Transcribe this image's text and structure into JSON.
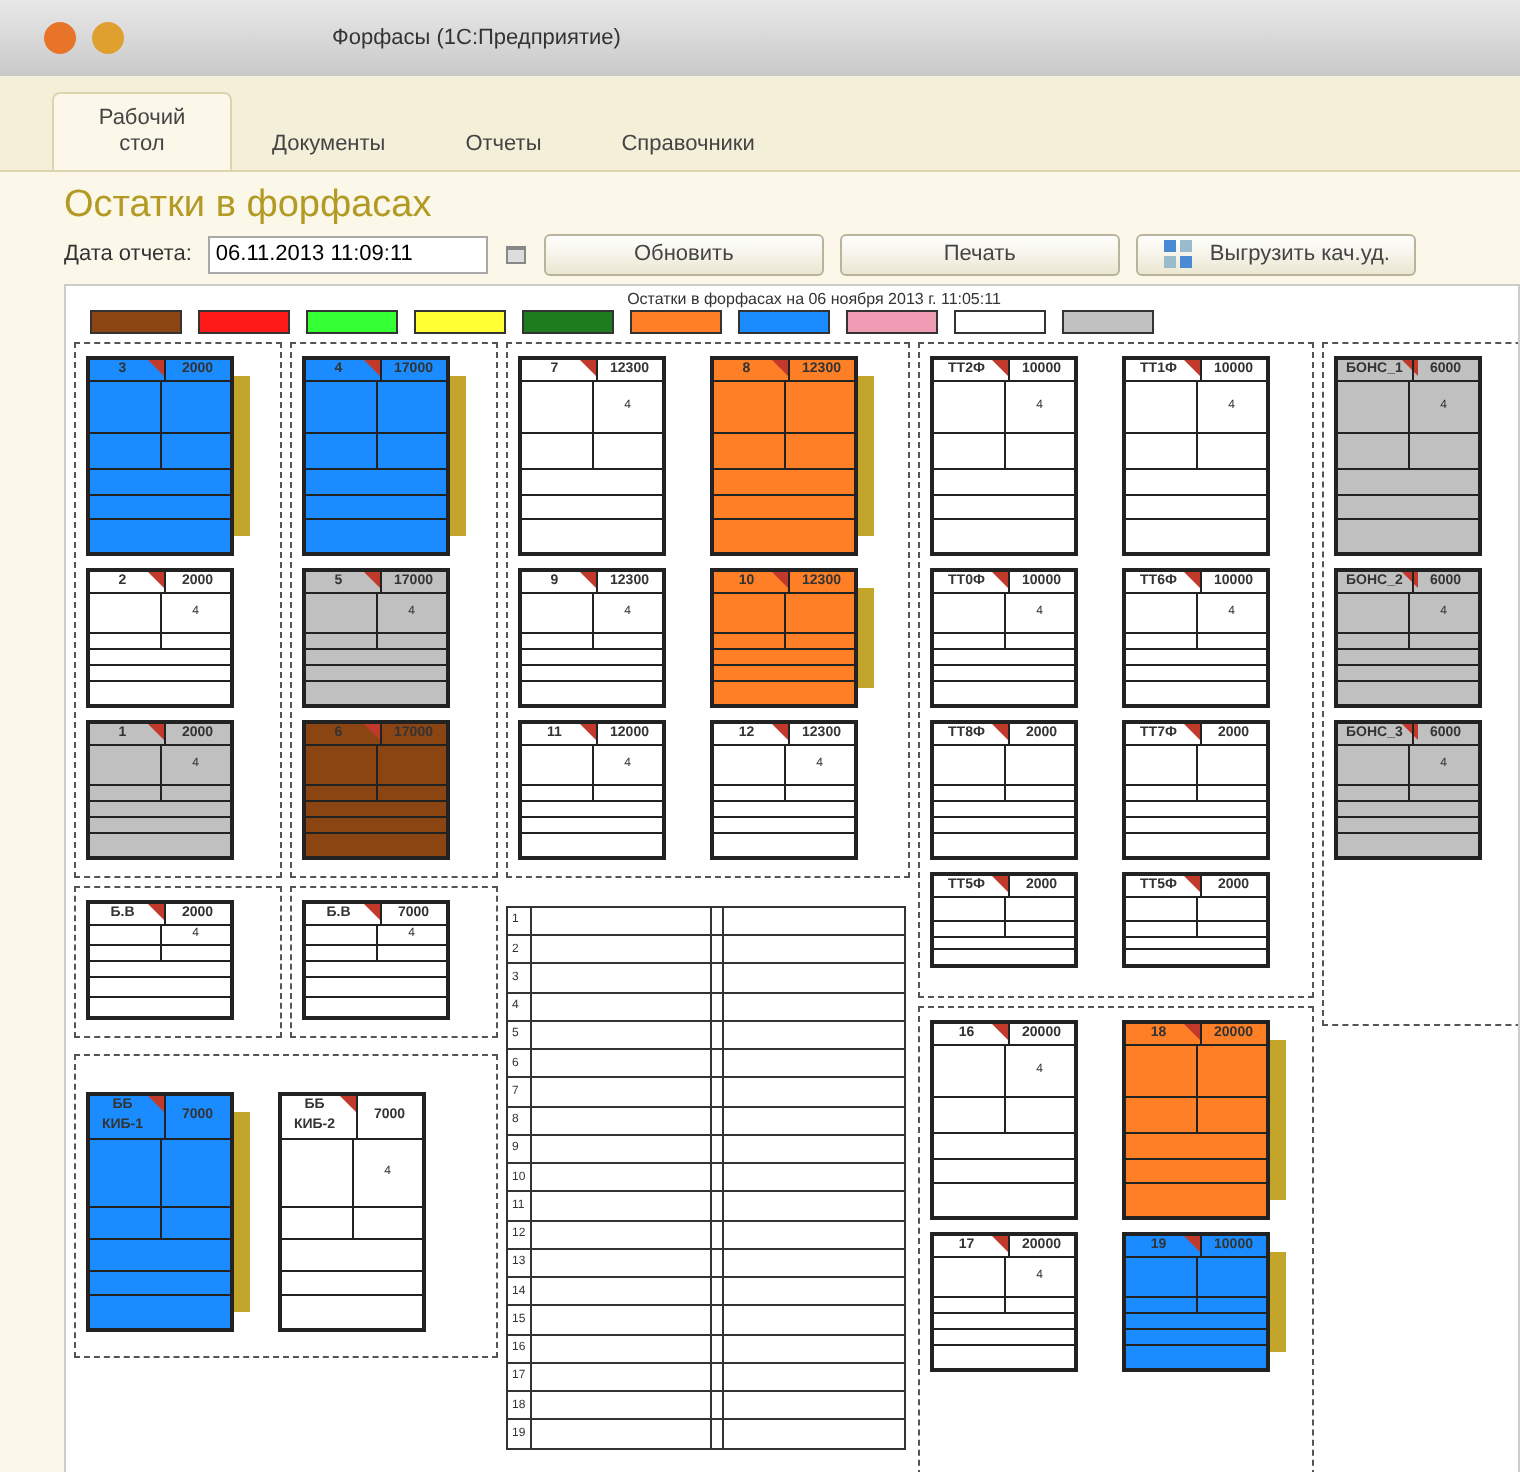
{
  "window": {
    "title": "Форфасы (1С:Предприятие)"
  },
  "tabs": [
    {
      "label": "Рабочий стол",
      "selected": true
    },
    {
      "label": "Документы",
      "selected": false
    },
    {
      "label": "Отчеты",
      "selected": false
    },
    {
      "label": "Справочники",
      "selected": false
    }
  ],
  "page_title": "Остатки в форфасах",
  "toolbar": {
    "date_label": "Дата отчета:",
    "date_value": "06.11.2013 11:09:11",
    "buttons": [
      {
        "label": "Обновить",
        "kind": "plain"
      },
      {
        "label": "Печать",
        "kind": "plain"
      },
      {
        "label": "Выгрузить кач.уд.",
        "kind": "export"
      }
    ]
  },
  "report": {
    "title": "Остатки в форфасах на 06 ноября 2013 г. 11:05:11",
    "legend": [
      {
        "color": "#8b4513"
      },
      {
        "color": "#ff1a1a"
      },
      {
        "color": "#33ff33"
      },
      {
        "color": "#ffff33"
      },
      {
        "color": "#1e7b1e"
      },
      {
        "color": "#ff7f27"
      },
      {
        "color": "#1a8cff"
      },
      {
        "color": "#f09cb4"
      },
      {
        "color": "#ffffff"
      },
      {
        "color": "#c0c0c0"
      }
    ],
    "left_groups": [
      {
        "cards": [
          {
            "number": "3",
            "capacity": "2000",
            "kind": "large",
            "color": "#1a8cff",
            "flagged": true
          },
          {
            "number": "2",
            "capacity": "2000",
            "quantity": "4",
            "kind": "small",
            "color": "#ffffff",
            "flagged": false
          },
          {
            "number": "1",
            "capacity": "2000",
            "quantity": "4",
            "kind": "small",
            "color": "#c0c0c0",
            "flagged": false
          }
        ]
      },
      {
        "cards": [
          {
            "number": "4",
            "capacity": "17000",
            "kind": "large",
            "color": "#1a8cff",
            "flagged": true
          },
          {
            "number": "5",
            "capacity": "17000",
            "quantity": "4",
            "kind": "small",
            "color": "#c0c0c0",
            "flagged": false
          },
          {
            "number": "6",
            "capacity": "17000",
            "kind": "small",
            "color": "#8b4513",
            "flagged": false
          }
        ]
      },
      {
        "cards": [
          {
            "number": "7",
            "capacity": "12300",
            "quantity": "4",
            "kind": "large",
            "color": "#ffffff",
            "flagged": false
          },
          {
            "number": "8",
            "capacity": "12300",
            "kind": "large",
            "color": "#ff7f27",
            "flagged": true
          },
          {
            "number": "9",
            "capacity": "12300",
            "quantity": "4",
            "kind": "small",
            "color": "#ffffff",
            "flagged": false
          },
          {
            "number": "10",
            "capacity": "12300",
            "kind": "small",
            "color": "#ff7f27",
            "flagged": true
          },
          {
            "number": "11",
            "capacity": "12000",
            "quantity": "4",
            "kind": "small",
            "color": "#ffffff",
            "flagged": false
          },
          {
            "number": "12",
            "capacity": "12300",
            "quantity": "4",
            "kind": "small",
            "color": "#ffffff",
            "flagged": false
          }
        ]
      }
    ],
    "mid_groups": [
      {
        "cards": [
          {
            "number": "Б.В",
            "capacity": "2000",
            "quantity": "4",
            "kind": "mini",
            "color": "#ffffff",
            "flagged": false
          }
        ]
      },
      {
        "cards": [
          {
            "number": "Б.В",
            "capacity": "7000",
            "quantity": "4",
            "kind": "mini",
            "color": "#ffffff",
            "flagged": false
          }
        ]
      },
      {
        "cards": [
          {
            "number": "ББ КИБ-1",
            "capacity": "7000",
            "kind": "tall",
            "color": "#1a8cff",
            "flagged": true
          },
          {
            "number": "ББ КИБ-2",
            "capacity": "7000",
            "quantity": "4",
            "kind": "tall",
            "color": "#ffffff",
            "flagged": false
          }
        ]
      }
    ],
    "table": {
      "rows": [
        "1",
        "2",
        "3",
        "4",
        "5",
        "6",
        "7",
        "8",
        "9",
        "10",
        "11",
        "12",
        "13",
        "14",
        "15",
        "16",
        "17",
        "18",
        "19"
      ]
    },
    "right_groups": [
      {
        "cards": [
          {
            "number": "ТТ2Ф",
            "capacity": "10000",
            "quantity": "4",
            "kind": "large",
            "color": "#ffffff",
            "flagged": false
          },
          {
            "number": "ТТ1Ф",
            "capacity": "10000",
            "quantity": "4",
            "kind": "large",
            "color": "#ffffff",
            "flagged": false
          },
          {
            "number": "ТТ0Ф",
            "capacity": "10000",
            "quantity": "4",
            "kind": "small",
            "color": "#ffffff",
            "flagged": false
          },
          {
            "number": "ТТ6Ф",
            "capacity": "10000",
            "quantity": "4",
            "kind": "small",
            "color": "#ffffff",
            "flagged": false
          },
          {
            "number": "ТТ8Ф",
            "capacity": "2000",
            "kind": "small",
            "color": "#ffffff",
            "flagged": false
          },
          {
            "number": "ТТ7Ф",
            "capacity": "2000",
            "kind": "small",
            "color": "#ffffff",
            "flagged": false
          },
          {
            "number": "ТТ5Ф",
            "capacity": "2000",
            "kind": "stub",
            "color": "#ffffff",
            "flagged": false
          },
          {
            "number": "ТТ5Ф",
            "capacity": "2000",
            "kind": "stub",
            "color": "#ffffff",
            "flagged": false
          }
        ]
      },
      {
        "cards": [
          {
            "number": "БОНС_1",
            "capacity": "6000",
            "quantity": "4",
            "kind": "large",
            "color": "#c0c0c0",
            "flagged": false
          },
          {
            "number": "БОНС_2",
            "capacity": "6000",
            "quantity": "4",
            "kind": "small",
            "color": "#c0c0c0",
            "flagged": false
          },
          {
            "number": "БОНС_3",
            "capacity": "6000",
            "quantity": "4",
            "kind": "small",
            "color": "#c0c0c0",
            "flagged": false
          }
        ]
      },
      {
        "cards": [
          {
            "number": "16",
            "capacity": "20000",
            "quantity": "4",
            "kind": "large",
            "color": "#ffffff",
            "flagged": false
          },
          {
            "number": "18",
            "capacity": "20000",
            "kind": "large",
            "color": "#ff7f27",
            "flagged": true
          },
          {
            "number": "17",
            "capacity": "20000",
            "quantity": "4",
            "kind": "small",
            "color": "#ffffff",
            "flagged": false
          },
          {
            "number": "19",
            "capacity": "10000",
            "kind": "small",
            "color": "#1a8cff",
            "flagged": true
          }
        ]
      }
    ]
  }
}
